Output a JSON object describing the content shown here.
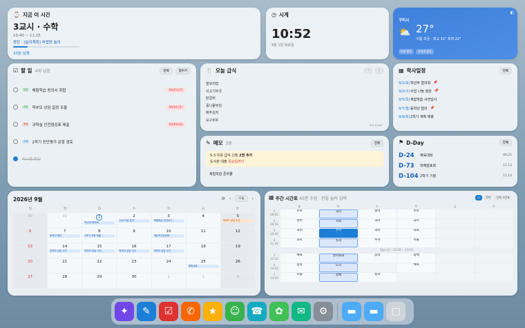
{
  "now": {
    "label": "지금 이 시간",
    "title": "3교시 · 수학",
    "time": "10:40 ~ 11:25",
    "class": "동탄 · [늘이계획] 비법방 놀이",
    "progress": 0.22,
    "remaining": "33분 남음"
  },
  "clock": {
    "label": "시계",
    "time": "10:52",
    "date": "9월 1일 화요일"
  },
  "weather": {
    "location": "구미시",
    "temp": "27°",
    "cond": "구름 조금 · 최고 31° 최저 22°",
    "tags": [
      "미세 좋음",
      "초미세 좋음"
    ]
  },
  "todo": {
    "label": "할 일",
    "count": "4개 남음",
    "buttons": [
      "전체",
      "접수기"
    ],
    "items": [
      {
        "tag": "담임",
        "tagColor": "#2f9e44",
        "text": "체험학습 동의서 취합",
        "due": "09/03(목)",
        "done": false
      },
      {
        "tag": "담임",
        "tagColor": "#2f9e44",
        "text": "학부모 상담 일정 조율",
        "due": "09/05(토)",
        "done": false
      },
      {
        "tag": "행정",
        "tagColor": "#d9480f",
        "text": "과학실 안전점검표 제출",
        "due": "09/09(화)",
        "done": false
      },
      {
        "tag": "수업",
        "tagColor": "#1c7ed6",
        "text": "2학기 진단평가 문항 검토",
        "due": "",
        "done": false
      },
      {
        "tag": "",
        "tagColor": "",
        "text": "독서록 확인",
        "due": "",
        "done": true
      }
    ]
  },
  "lunch": {
    "label": "오늘 급식",
    "items": [
      "찰보리밥",
      "쇠고기무국",
      "닭갈비",
      "콩나물무침",
      "배추김치",
      "요구르트"
    ],
    "kcal": "674.8 kcal"
  },
  "memo": {
    "label": "메모",
    "count": "3장",
    "button": "전체",
    "line1_pre": "5-3 우유 급식 신청 ",
    "line1_bold": "2명 추가",
    "line2_pre": "도서관 대출 ",
    "line2_red": "목요일까지",
    "extra": "체험학습 준비물"
  },
  "schedule": {
    "label": "학사일정",
    "button": "전체",
    "items": [
      {
        "date": "9/1(화)",
        "text": "학년부 협의회",
        "pin": true
      },
      {
        "date": "9/2(수)",
        "text": "수업 나눔 참관",
        "pin": true
      },
      {
        "date": "9/3(목)",
        "text": "체험학습 사전답사",
        "pin": false
      },
      {
        "date": "9/7(월)",
        "text": "동학년 협의",
        "pin": true
      },
      {
        "date": "9/8(화)",
        "text": "2학기 계획 제출",
        "pin": false
      }
    ]
  },
  "dday": {
    "label": "D-Day",
    "button": "전체",
    "items": [
      {
        "d": "D-24",
        "name": "체육대회",
        "date": "09.25"
      },
      {
        "d": "D-73",
        "name": "학예발표회",
        "date": "11.13"
      },
      {
        "d": "D-104",
        "name": "2학기 기말",
        "date": "12.14"
      }
    ]
  },
  "calendar": {
    "title": "2026년 9월",
    "today_btn": "오늘",
    "weekdays": [
      "일",
      "월",
      "화",
      "수",
      "목",
      "금",
      "토"
    ],
    "cells": [
      {
        "n": "30",
        "cls": "sun mute",
        "ev": []
      },
      {
        "n": "31",
        "cls": "mute",
        "ev": []
      },
      {
        "n": "1",
        "cls": "today",
        "ev": [
          {
            "t": "학년부 협의회",
            "c": ""
          }
        ]
      },
      {
        "n": "2",
        "cls": "",
        "ev": [
          {
            "t": "수업 나눔 참관",
            "c": ""
          }
        ]
      },
      {
        "n": "3",
        "cls": "",
        "ev": [
          {
            "t": "체험학습 사전답사",
            "c": ""
          }
        ]
      },
      {
        "n": "4",
        "cls": "",
        "ev": []
      },
      {
        "n": "5",
        "cls": "sun",
        "ev": [
          {
            "t": "학부모 상담 주간",
            "c": "pk"
          }
        ]
      },
      {
        "n": "6",
        "cls": "sun red",
        "ev": []
      },
      {
        "n": "7",
        "cls": "",
        "ev": [
          {
            "t": "동학년 협의",
            "c": ""
          }
        ]
      },
      {
        "n": "8",
        "cls": "",
        "ev": [
          {
            "t": "2학기 계획 제출",
            "c": ""
          }
        ]
      },
      {
        "n": "9",
        "cls": "",
        "ev": []
      },
      {
        "n": "10",
        "cls": "",
        "ev": [
          {
            "t": "9월 학교운영위",
            "c": ""
          }
        ]
      },
      {
        "n": "11",
        "cls": "",
        "ev": []
      },
      {
        "n": "12",
        "cls": "sun",
        "ev": []
      },
      {
        "n": "13",
        "cls": "sun red",
        "ev": []
      },
      {
        "n": "14",
        "cls": "",
        "ev": [
          {
            "t": "학부모 상담 주간",
            "c": ""
          }
        ]
      },
      {
        "n": "15",
        "cls": "",
        "ev": [
          {
            "t": "학부모 상담 주간",
            "c": ""
          }
        ]
      },
      {
        "n": "16",
        "cls": "",
        "ev": [
          {
            "t": "학부모 상담 주간",
            "c": ""
          }
        ]
      },
      {
        "n": "17",
        "cls": "",
        "ev": [
          {
            "t": "학부모 상담 주간",
            "c": ""
          }
        ]
      },
      {
        "n": "18",
        "cls": "",
        "ev": []
      },
      {
        "n": "19",
        "cls": "sun",
        "ev": []
      },
      {
        "n": "20",
        "cls": "sun red",
        "ev": []
      },
      {
        "n": "21",
        "cls": "",
        "ev": []
      },
      {
        "n": "22",
        "cls": "",
        "ev": []
      },
      {
        "n": "23",
        "cls": "",
        "ev": []
      },
      {
        "n": "24",
        "cls": "",
        "ev": []
      },
      {
        "n": "25",
        "cls": "",
        "ev": [
          {
            "t": "체육대회",
            "c": ""
          }
        ]
      },
      {
        "n": "26",
        "cls": "sun",
        "ev": []
      },
      {
        "n": "27",
        "cls": "sun red",
        "ev": []
      },
      {
        "n": "28",
        "cls": "",
        "ev": []
      },
      {
        "n": "29",
        "cls": "",
        "ev": []
      },
      {
        "n": "30",
        "cls": "",
        "ev": []
      },
      {
        "n": "1",
        "cls": "mute",
        "ev": []
      },
      {
        "n": "2",
        "cls": "mute",
        "ev": []
      },
      {
        "n": "3",
        "cls": "sun mute",
        "ev": []
      }
    ]
  },
  "timetable": {
    "title": "주간 시간표",
    "subtitle": "45분 수업 · 칸을 눌러 입력",
    "tabs": [
      "나",
      "학반",
      "전체 시간표"
    ],
    "days": [
      "월",
      "화",
      "수",
      "목",
      "금",
      "토"
    ],
    "rows": [
      {
        "p": "1",
        "t": "09:00",
        "c": [
          [
            "수학",
            ""
          ],
          [
            "국어",
            ""
          ],
          [
            "영어",
            ""
          ],
          [
            "수학",
            ""
          ],
          [
            "",
            ""
          ],
          [
            "",
            ""
          ]
        ],
        "hl": 1
      },
      {
        "p": "2",
        "t": "09:50",
        "c": [
          [
            "영어",
            ""
          ],
          [
            "사회",
            ""
          ],
          [
            "국어",
            ""
          ],
          [
            "국어",
            ""
          ],
          [
            "",
            ""
          ],
          [
            "",
            ""
          ]
        ],
        "hl": 1
      },
      {
        "p": "3",
        "t": "10:40",
        "c": [
          [
            "국어",
            ""
          ],
          [
            "수학",
            "",
            ""
          ],
          [
            "과학",
            ""
          ],
          [
            "사회",
            ""
          ],
          [
            "",
            ""
          ],
          [
            "",
            ""
          ]
        ],
        "now": 1
      },
      {
        "p": "4",
        "t": "11:30",
        "c": [
          [
            "과학",
            ""
          ],
          [
            "실과",
            ""
          ],
          [
            "수학",
            ""
          ],
          [
            "미술",
            ""
          ],
          [
            "",
            ""
          ],
          [
            "",
            ""
          ]
        ],
        "hl": 1
      },
      {
        "p": "5",
        "t": "13:10",
        "c": [
          [
            "체육",
            ""
          ],
          [
            "영어회화",
            ""
          ],
          [
            "음악",
            ""
          ],
          [
            "창체",
            ""
          ],
          [
            "",
            ""
          ],
          [
            "",
            ""
          ]
        ],
        "hl": 1
      },
      {
        "p": "6",
        "t": "14:00",
        "c": [
          [
            "음악",
            ""
          ],
          [
            "도덕",
            ""
          ],
          [
            "",
            ""
          ],
          [
            "체육",
            ""
          ],
          [
            "",
            ""
          ],
          [
            "",
            ""
          ]
        ],
        "hl": 1
      },
      {
        "p": "7",
        "t": "14:50",
        "c": [
          [
            "미술",
            ""
          ],
          [
            "창체",
            ""
          ],
          [
            "실과",
            ""
          ],
          [
            "",
            ""
          ],
          [
            "",
            ""
          ],
          [
            "",
            ""
          ]
        ],
        "hl": 1
      }
    ],
    "lunch": "점심시간 · 12:20 ~ 13:10"
  },
  "dock": [
    {
      "name": "ai-assistant-icon",
      "bg": "#7048e8",
      "g": "✦"
    },
    {
      "name": "pen-icon",
      "bg": "#1c7ed6",
      "g": "✎"
    },
    {
      "name": "checklist-icon",
      "bg": "#e03131",
      "g": "☑"
    },
    {
      "name": "megaphone-icon",
      "bg": "#f76707",
      "g": "✆"
    },
    {
      "name": "star-icon",
      "bg": "#fab005",
      "g": "★"
    },
    {
      "name": "people-icon",
      "bg": "#37b24d",
      "g": "☺"
    },
    {
      "name": "phone-icon",
      "bg": "#15aabf",
      "g": "☎"
    },
    {
      "name": "broom-icon",
      "bg": "#40c057",
      "g": "✿"
    },
    {
      "name": "chat-icon",
      "bg": "#12b886",
      "g": "✉"
    },
    {
      "name": "settings-icon",
      "bg": "#868e96",
      "g": "⚙"
    },
    {
      "name": "folder-icon",
      "bg": "#4dabf7",
      "g": "▬"
    },
    {
      "name": "folder2-icon",
      "bg": "#4dabf7",
      "g": "▬"
    },
    {
      "name": "trash-icon",
      "bg": "#ced4da",
      "g": "▢"
    }
  ]
}
